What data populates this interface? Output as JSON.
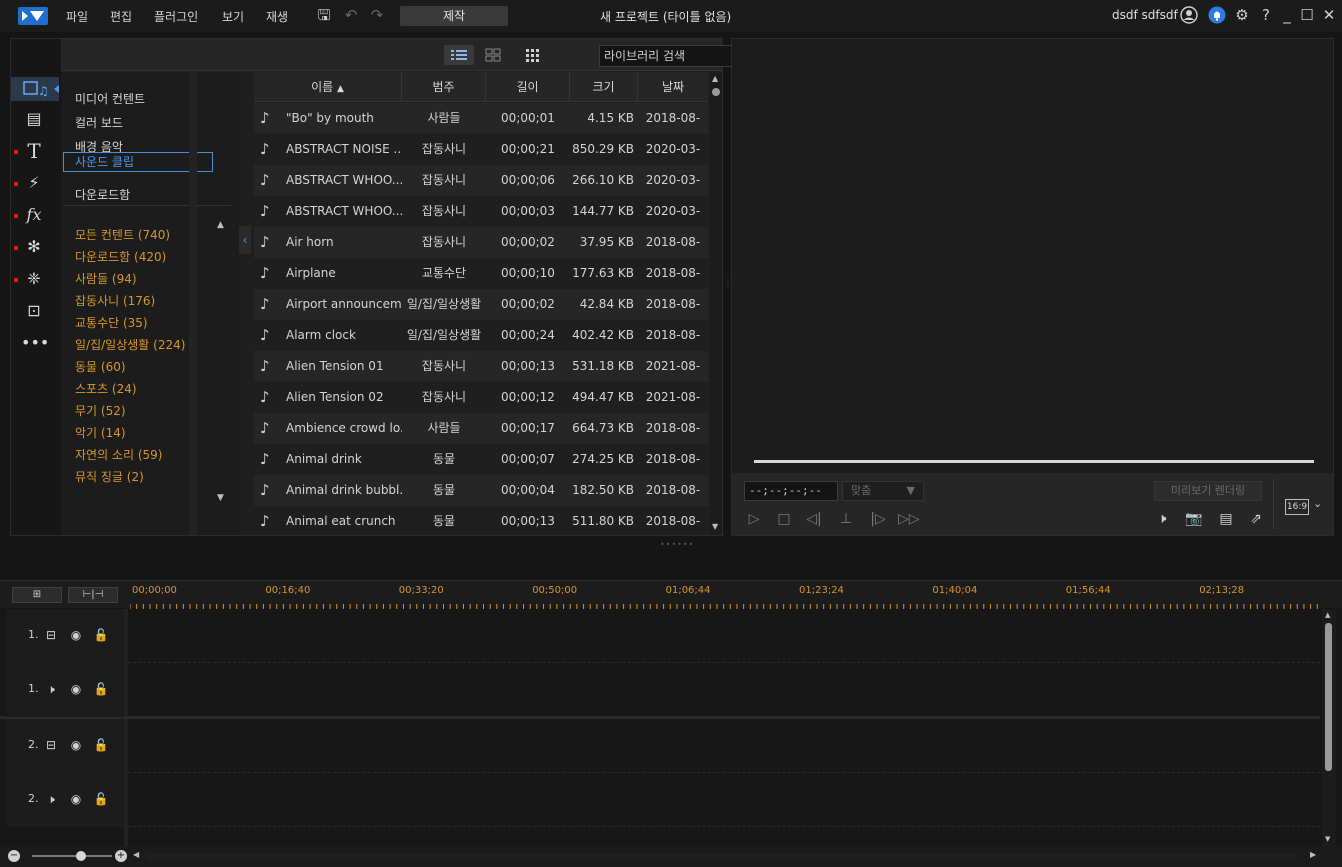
{
  "menu": [
    "파일",
    "편집",
    "플러그인",
    "보기",
    "재생"
  ],
  "produce_label": "제작",
  "project_title": "새 프로젝트 (타이틀 없음)",
  "user_name": "dsdf sdfsdf",
  "library": {
    "search_placeholder": "라이브러리 검색",
    "categories": [
      "미디어 컨텐트",
      "컬러 보드",
      "배경 음악",
      "사운드 클립",
      "다운로드함"
    ],
    "selected_category": "사운드 클립",
    "subcategories": [
      "모든 컨텐트  (740)",
      "다운로드함  (420)",
      "사람들  (94)",
      "잡동사니  (176)",
      "교통수단  (35)",
      "일/집/일상생활  (224)",
      "동물  (60)",
      "스포츠  (24)",
      "무기  (52)",
      "악기  (14)",
      "자연의 소리  (59)",
      "뮤직 징글  (2)"
    ],
    "columns": [
      "이름",
      "범주",
      "길이",
      "크기",
      "날짜"
    ],
    "rows": [
      [
        "\"Bo\" by mouth",
        "사람들",
        "00;00;01",
        "4.15 KB",
        "2018-08-"
      ],
      [
        "ABSTRACT NOISE ...",
        "잡동사니",
        "00;00;21",
        "850.29 KB",
        "2020-03-"
      ],
      [
        "ABSTRACT WHOO...",
        "잡동사니",
        "00;00;06",
        "266.10 KB",
        "2020-03-"
      ],
      [
        "ABSTRACT WHOO...",
        "잡동사니",
        "00;00;03",
        "144.77 KB",
        "2020-03-"
      ],
      [
        "Air horn",
        "잡동사니",
        "00;00;02",
        "37.95 KB",
        "2018-08-"
      ],
      [
        "Airplane",
        "교통수단",
        "00;00;10",
        "177.63 KB",
        "2018-08-"
      ],
      [
        "Airport announcem...",
        "일/집/일상생활",
        "00;00;02",
        "42.84 KB",
        "2018-08-"
      ],
      [
        "Alarm clock",
        "일/집/일상생활",
        "00;00;24",
        "402.42 KB",
        "2018-08-"
      ],
      [
        "Alien Tension 01",
        "잡동사니",
        "00;00;13",
        "531.18 KB",
        "2021-08-"
      ],
      [
        "Alien Tension 02",
        "잡동사니",
        "00;00;12",
        "494.47 KB",
        "2021-08-"
      ],
      [
        "Ambience crowd lo...",
        "사람들",
        "00;00;17",
        "664.73 KB",
        "2018-08-"
      ],
      [
        "Animal drink",
        "동물",
        "00;00;07",
        "274.25 KB",
        "2018-08-"
      ],
      [
        "Animal drink bubbl...",
        "동물",
        "00;00;04",
        "182.50 KB",
        "2018-08-"
      ],
      [
        "Animal eat crunch",
        "동물",
        "00;00;13",
        "511.80 KB",
        "2018-08-"
      ]
    ]
  },
  "preview": {
    "timecode": "--;--;--;--",
    "fit_label": "맞춤",
    "render_label": "미리보기 렌더링",
    "ratio": "16:9"
  },
  "timeline": {
    "ticks": [
      "00;00;00",
      "00;16;40",
      "00;33;20",
      "00;50;00",
      "01;06;44",
      "01;23;24",
      "01;40;04",
      "01;56;44",
      "02;13;28"
    ],
    "tracks": [
      "1.",
      "1.",
      "2.",
      "2."
    ]
  },
  "colors": {
    "accent": "#4a9be8",
    "orange": "#d9962a"
  }
}
